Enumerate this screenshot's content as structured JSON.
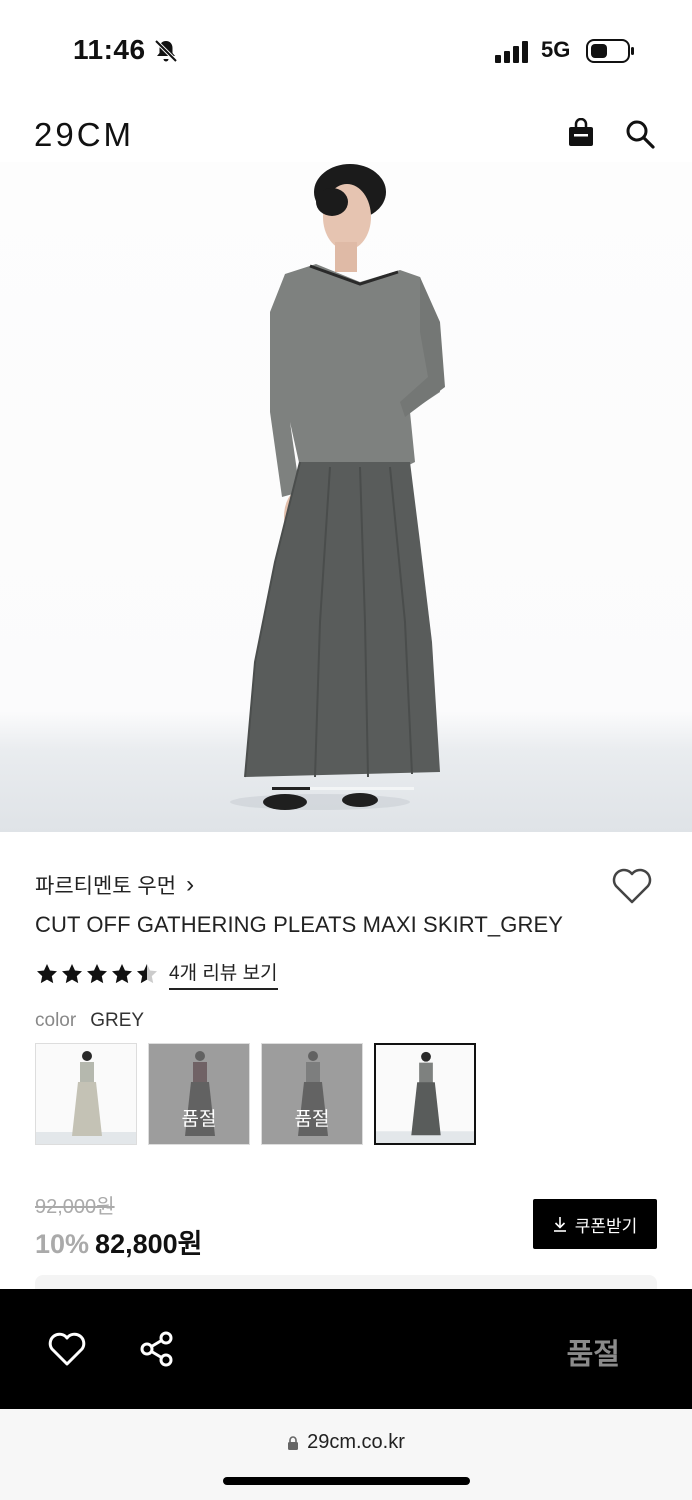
{
  "status_bar": {
    "time": "11:46",
    "network": "5G"
  },
  "header": {
    "logo": "29CM",
    "icons": [
      "shopping-bag-icon",
      "search-icon"
    ]
  },
  "product": {
    "brand": "파르티멘토 우먼",
    "brand_chevron": "›",
    "title": "CUT OFF GATHERING PLEATS MAXI SKIRT_GREY",
    "rating": 4.5,
    "review_link": "4개 리뷰 보기",
    "color_label": "color",
    "color_value": "GREY",
    "swatches": [
      {
        "soldout_label": ""
      },
      {
        "soldout_label": "품절"
      },
      {
        "soldout_label": "품절"
      },
      {
        "soldout_label": ""
      }
    ],
    "original_price": "92,000원",
    "discount": "10%",
    "price": "82,800원",
    "coupon_label": "쿠폰받기"
  },
  "bottom_bar": {
    "soldout_label": "품절"
  },
  "browser": {
    "url": "29cm.co.kr"
  },
  "colors": {
    "accent": "#000000",
    "muted": "#aaaaaa",
    "soldout": "#8b8b8b"
  }
}
